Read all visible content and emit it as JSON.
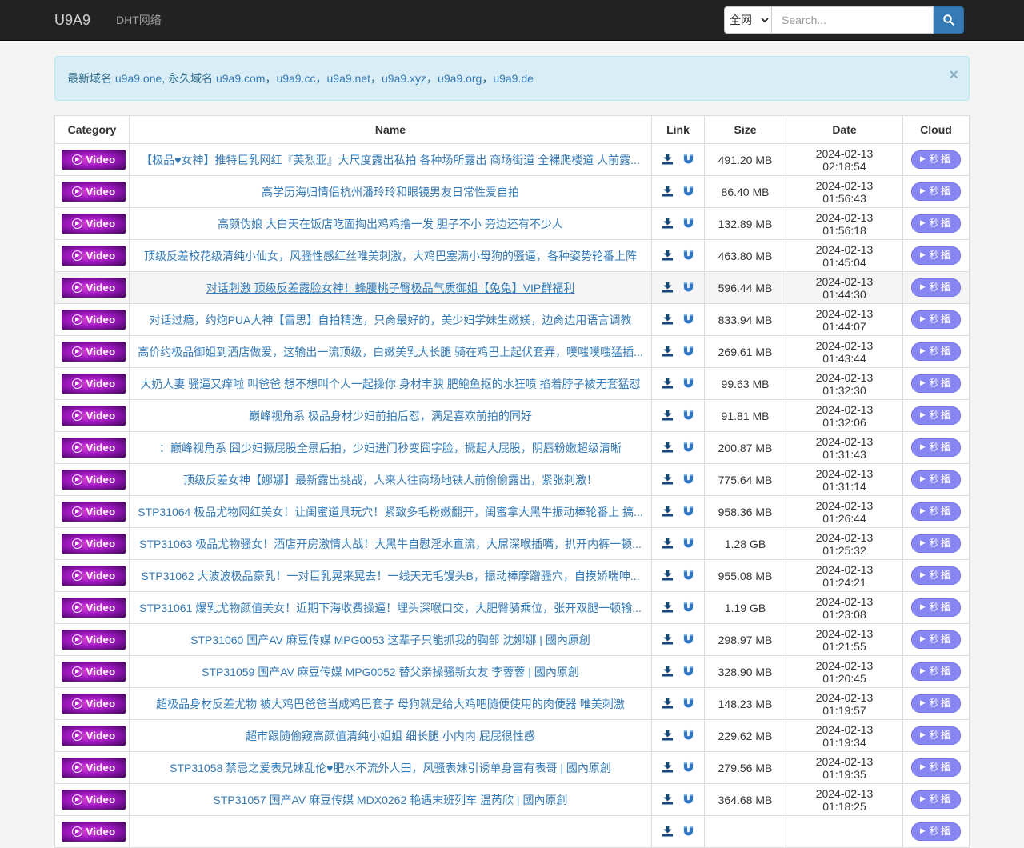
{
  "navbar": {
    "brand": "U9A9",
    "dht_label": "DHT网络",
    "search": {
      "scope": "全网",
      "placeholder": "Search..."
    }
  },
  "notice": {
    "parts": [
      "最新域名 ",
      "u9a9.one,",
      " 永久域名 ",
      "u9a9.com",
      "，",
      "u9a9.cc",
      "，",
      "u9a9.net",
      "，",
      "u9a9.xyz",
      "，",
      "u9a9.org",
      "，",
      "u9a9.de"
    ],
    "close": "×"
  },
  "table": {
    "headers": [
      "Category",
      "Name",
      "Link",
      "Size",
      "Date",
      "Cloud"
    ],
    "category_label": "Video",
    "play_label": "秒播",
    "rows": [
      {
        "name": "【极品♥女神】推特巨乳网红『芙烈亚』大尺度露出私拍 各种场所露出 商场街道 全裸爬楼道 人前露...",
        "size": "491.20 MB",
        "date": "2024-02-13 02:18:54"
      },
      {
        "name": "高学历海归情侣杭州潘玲玲和眼镜男友日常性爱自拍",
        "size": "86.40 MB",
        "date": "2024-02-13 01:56:43"
      },
      {
        "name": "高颜伪娘 大白天在饭店吃面掏出鸡鸡撸一发 胆子不小 旁边还有不少人",
        "size": "132.89 MB",
        "date": "2024-02-13 01:56:18"
      },
      {
        "name": "顶级反差校花级清纯小仙女，风骚性感红丝唯美刺激，大鸡巴塞满小母狗的骚逼，各种姿势轮番上阵",
        "size": "463.80 MB",
        "date": "2024-02-13 01:45:04"
      },
      {
        "name": "对话刺激 顶级反差露脸女神！蜂腰桃子臀极品气质御姐【兔兔】VIP群福利",
        "size": "596.44 MB",
        "date": "2024-02-13 01:44:30",
        "highlight": true
      },
      {
        "name": "对话过瘾，约炮PUA大神【雷思】自拍精选，只肏最好的，美少妇学妹生嫩媄，边肏边用语言调教",
        "size": "833.94 MB",
        "date": "2024-02-13 01:44:07"
      },
      {
        "name": "高价约极品御姐到酒店做爱，这输出一流顶级，白嫩美乳大长腿 骑在鸡巴上起伏套弄，噗嗤噗嗤猛插...",
        "size": "269.61 MB",
        "date": "2024-02-13 01:43:44"
      },
      {
        "name": "大奶人妻 骚逼又痒啦 叫爸爸 想不想叫个人一起操你 身材丰腴 肥鲍鱼抠的水狂喷 掐着脖子被无套猛怼",
        "size": "99.63 MB",
        "date": "2024-02-13 01:32:30"
      },
      {
        "name": "巅峰视角系 极品身材少妇前拍后怼，满足喜欢前拍的同好",
        "size": "91.81 MB",
        "date": "2024-02-13 01:32:06"
      },
      {
        "name": "：巅峰视角系 囧少妇撅屁股全景后拍，少妇进门秒变囧字脸，撅起大屁股，阴唇粉嫩超级清晰",
        "size": "200.87 MB",
        "date": "2024-02-13 01:31:43"
      },
      {
        "name": "顶级反差女神【娜娜】最新露出挑战，人来人往商场地铁人前偷偷露出，紧张刺激！",
        "size": "775.64 MB",
        "date": "2024-02-13 01:31:14"
      },
      {
        "name": "STP31064 极品尤物网红美女！让闺蜜道具玩穴！紧致多毛粉嫩翻开，闺蜜拿大黑牛振动棒轮番上 搞...",
        "size": "958.36 MB",
        "date": "2024-02-13 01:26:44"
      },
      {
        "name": "STP31063 极品尤物骚女！酒店开房激情大战！大黑牛自慰淫水直流，大屌深喉插嘴，扒开内裤一顿...",
        "size": "1.28 GB",
        "date": "2024-02-13 01:25:32"
      },
      {
        "name": "STP31062 大波波极品豪乳！一对巨乳晃来晃去！一线天无毛馒头B，振动棒摩蹭骚穴，自摸娇喘呻...",
        "size": "955.08 MB",
        "date": "2024-02-13 01:24:21"
      },
      {
        "name": "STP31061 爆乳尤物颜值美女！近期下海收费操逼！埋头深喉口交，大肥臀骑乘位，张开双腿一顿输...",
        "size": "1.19 GB",
        "date": "2024-02-13 01:23:08"
      },
      {
        "name": "STP31060 国产AV 麻豆传媒 MPG0053 这辈子只能抓我的胸部 沈娜娜 | 國內原創",
        "size": "298.97 MB",
        "date": "2024-02-13 01:21:55"
      },
      {
        "name": "STP31059 国产AV 麻豆传媒 MPG0052 替父亲操骚新女友 李蓉蓉 | 國內原創",
        "size": "328.90 MB",
        "date": "2024-02-13 01:20:45"
      },
      {
        "name": "超极品身材反差尤物 被大鸡巴爸爸当成鸡巴套子 母狗就是给大鸡吧随便使用的肉便器 唯美刺激",
        "size": "148.23 MB",
        "date": "2024-02-13 01:19:57"
      },
      {
        "name": "超市跟随偷窥高颜值清纯小姐姐 细长腿 小内内 屁屁很性感",
        "size": "229.62 MB",
        "date": "2024-02-13 01:19:34"
      },
      {
        "name": "STP31058 禁忌之爱表兄妹乱伦♥肥水不流外人田，风骚表妹引诱单身富有表哥 | 國內原創",
        "size": "279.56 MB",
        "date": "2024-02-13 01:19:35"
      },
      {
        "name": "STP31057 国产AV 麻豆传媒 MDX0262 艳遇末班列车 温芮欣 | 國內原創",
        "size": "364.68 MB",
        "date": "2024-02-13 01:18:25"
      },
      {
        "name": "",
        "size": "",
        "date": "",
        "partial": true
      }
    ]
  }
}
